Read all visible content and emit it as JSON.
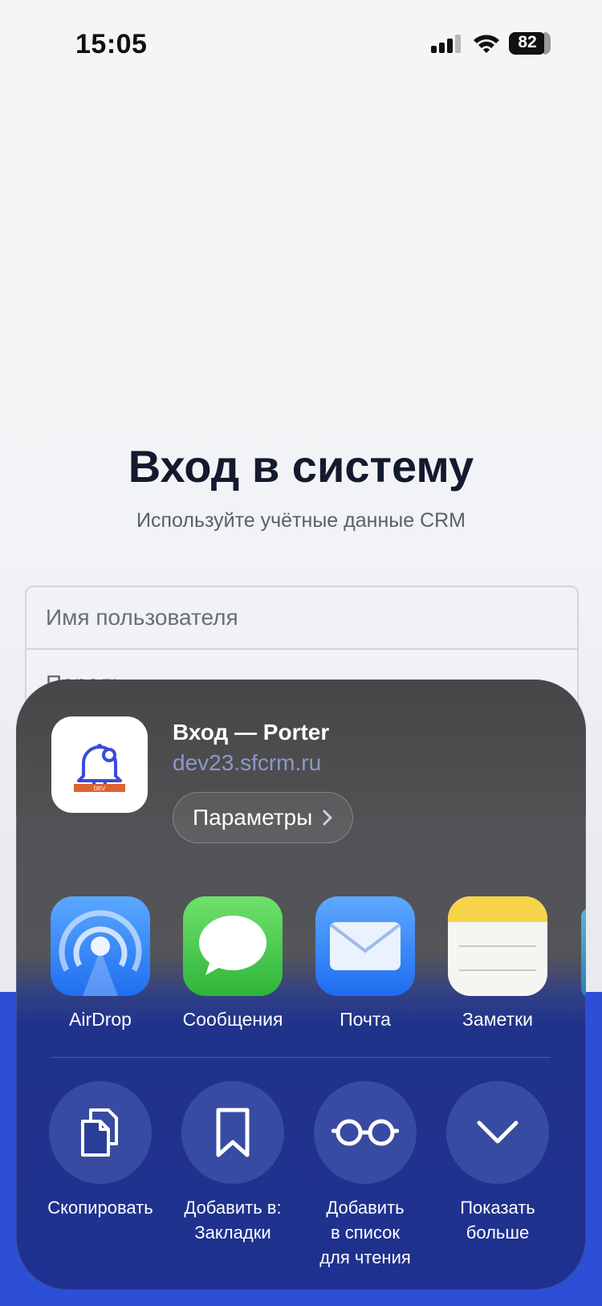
{
  "status_bar": {
    "time": "15:05",
    "battery": "82"
  },
  "login": {
    "title": "Вход в систему",
    "subtitle": "Используйте учётные данные CRM",
    "username_placeholder": "Имя пользователя",
    "password_placeholder": "Пароль"
  },
  "share_sheet": {
    "title": "Вход — Porter",
    "url": "dev23.sfcrm.ru",
    "options_label": "Параметры",
    "app_badge": "DEV",
    "apps": [
      {
        "label": "AirDrop",
        "icon": "airdrop-icon"
      },
      {
        "label": "Сообщения",
        "icon": "messages-icon"
      },
      {
        "label": "Почта",
        "icon": "mail-icon"
      },
      {
        "label": "Заметки",
        "icon": "notes-icon"
      }
    ],
    "actions": [
      {
        "label": "Скопировать",
        "icon": "copy-icon"
      },
      {
        "label": "Добавить в:\nЗакладки",
        "icon": "bookmark-icon"
      },
      {
        "label": "Добавить\nв список\nдля чтения",
        "icon": "glasses-icon"
      },
      {
        "label": "Показать\nбольше",
        "icon": "chevron-down-icon"
      }
    ]
  }
}
